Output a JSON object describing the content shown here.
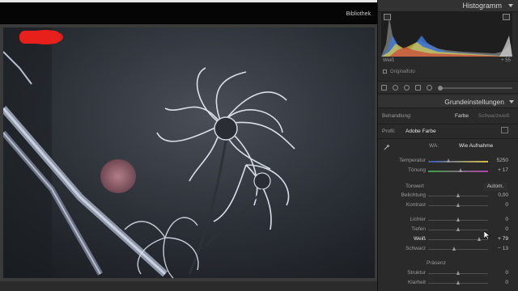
{
  "module_bar": {
    "library_label": "Bibliothek"
  },
  "histogram": {
    "title": "Histogramm",
    "readout_label": "Weiß",
    "readout_value": "+ 55",
    "original_photo_label": "Originalfoto"
  },
  "basic": {
    "title": "Grundeinstellungen",
    "treatment_label": "Behandlung:",
    "treatment_options": [
      "Farbe",
      "Schwarzweiß"
    ],
    "treatment_selected": "Farbe",
    "profile_label": "Profil:",
    "profile_value": "Adobe Farbe",
    "wb_label": "WA:",
    "wb_value": "Wie Aufnahme",
    "sliders_wb": [
      {
        "label": "Temperatur",
        "value": "5250",
        "pos": 0.35
      },
      {
        "label": "Tönung",
        "value": "+ 17",
        "pos": 0.55
      }
    ],
    "tone_label": "Tonwert",
    "auto_label": "Autom.",
    "sliders_tone": [
      {
        "label": "Belichtung",
        "value": "0,00",
        "pos": 0.5
      },
      {
        "label": "Kontrast",
        "value": "0",
        "pos": 0.5
      }
    ],
    "sliders_tone2": [
      {
        "label": "Lichter",
        "value": "0",
        "pos": 0.5
      },
      {
        "label": "Tiefen",
        "value": "0",
        "pos": 0.5
      },
      {
        "label": "Weiß",
        "value": "+ 79",
        "pos": 0.86
      },
      {
        "label": "Schwarz",
        "value": "− 13",
        "pos": 0.44
      }
    ],
    "presence_label": "Präsenz",
    "sliders_presence": [
      {
        "label": "Struktur",
        "value": "0",
        "pos": 0.5
      },
      {
        "label": "Klarheit",
        "value": "0",
        "pos": 0.5
      }
    ]
  },
  "colors": {
    "panel_bg": "#2a2a2a",
    "header_bg": "#323232",
    "photo_bg": "#3a3a3a",
    "frost": "#dfe6f0"
  }
}
